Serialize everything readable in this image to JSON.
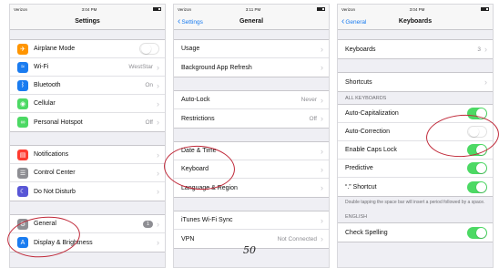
{
  "status": {
    "carrier": "Verizon",
    "time1": "3:04 PM",
    "time2": "3:11 PM",
    "time3": "3:04 PM"
  },
  "settings": {
    "title": "Settings",
    "groups": [
      [
        {
          "label": "Airplane Mode",
          "icon": "airplane-icon",
          "color": "#ff9500",
          "glyph": "✈",
          "toggle": "off"
        },
        {
          "label": "Wi-Fi",
          "icon": "wifi-icon",
          "color": "#1a7cf0",
          "glyph": "≈",
          "value": "WestStar"
        },
        {
          "label": "Bluetooth",
          "icon": "bluetooth-icon",
          "color": "#1a7cf0",
          "glyph": "ᛒ",
          "value": "On"
        },
        {
          "label": "Cellular",
          "icon": "cellular-icon",
          "color": "#4cd964",
          "glyph": "◉"
        },
        {
          "label": "Personal Hotspot",
          "icon": "hotspot-icon",
          "color": "#4cd964",
          "glyph": "∞",
          "value": "Off"
        }
      ],
      [
        {
          "label": "Notifications",
          "icon": "notifications-icon",
          "color": "#ff3b30",
          "glyph": "▤"
        },
        {
          "label": "Control Center",
          "icon": "control-center-icon",
          "color": "#8e8e93",
          "glyph": "☰"
        },
        {
          "label": "Do Not Disturb",
          "icon": "moon-icon",
          "color": "#5856d6",
          "glyph": "☾"
        }
      ],
      [
        {
          "label": "General",
          "icon": "gear-icon",
          "color": "#8e8e93",
          "glyph": "⚙",
          "badge": "1"
        },
        {
          "label": "Display & Brightness",
          "icon": "display-icon",
          "color": "#1a7cf0",
          "glyph": "A"
        }
      ]
    ]
  },
  "general": {
    "title": "General",
    "back": "Settings",
    "groups": [
      [
        {
          "label": "Usage"
        },
        {
          "label": "Background App Refresh"
        }
      ],
      [
        {
          "label": "Auto-Lock",
          "value": "Never"
        },
        {
          "label": "Restrictions",
          "value": "Off"
        }
      ],
      [
        {
          "label": "Date & Time"
        },
        {
          "label": "Keyboard"
        },
        {
          "label": "Language & Region"
        }
      ],
      [
        {
          "label": "iTunes Wi-Fi Sync"
        },
        {
          "label": "VPN",
          "value": "Not Connected"
        }
      ]
    ]
  },
  "keyboards": {
    "title": "Keyboards",
    "back": "General",
    "group1": [
      {
        "label": "Keyboards",
        "value": "3"
      }
    ],
    "group2": [
      {
        "label": "Shortcuts"
      }
    ],
    "all_header": "ALL KEYBOARDS",
    "group3": [
      {
        "label": "Auto-Capitalization",
        "toggle": "on"
      },
      {
        "label": "Auto-Correction",
        "toggle": "off"
      },
      {
        "label": "Enable Caps Lock",
        "toggle": "on"
      },
      {
        "label": "Predictive",
        "toggle": "on"
      },
      {
        "label": "“.” Shortcut",
        "toggle": "on"
      }
    ],
    "footnote": "Double tapping the space bar will insert a period followed by a space.",
    "english_header": "ENGLISH",
    "group4": [
      {
        "label": "Check Spelling",
        "toggle": "on"
      }
    ]
  },
  "page_number": "50"
}
